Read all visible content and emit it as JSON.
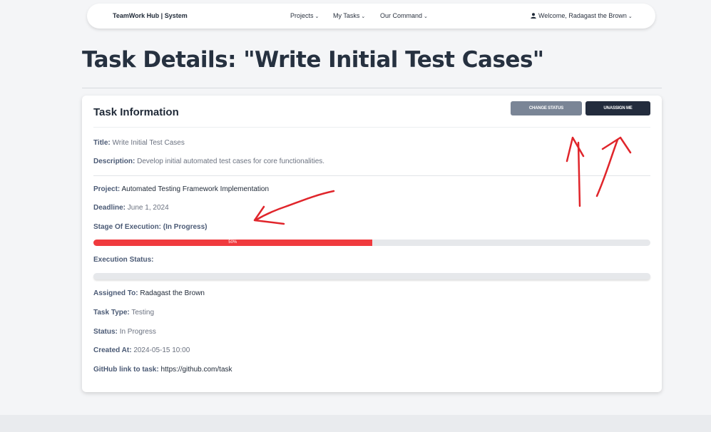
{
  "nav": {
    "brand": "TeamWork Hub | System",
    "projects": "Projects",
    "my_tasks": "My Tasks",
    "our_command": "Our Command",
    "user": "Welcome, Radagast the Brown"
  },
  "page": {
    "title": "Task Details: \"Write Initial Test Cases\""
  },
  "card": {
    "title": "Task Information",
    "change_status_label": "CHANGE STATUS",
    "unassign_label": "UNASSIGN ME"
  },
  "fields": {
    "title_label": "Title:",
    "title_value": "Write Initial Test Cases",
    "description_label": "Description:",
    "description_value": "Develop initial automated test cases for core functionalities.",
    "project_label": "Project:",
    "project_value": "Automated Testing Framework Implementation",
    "deadline_label": "Deadline:",
    "deadline_value": "June 1, 2024",
    "stage_label": "Stage Of Execution: (In Progress)",
    "stage_progress": 50,
    "stage_progress_text": "50%",
    "execution_label": "Execution Status:",
    "execution_progress": 0,
    "assigned_label": "Assigned To:",
    "assigned_value": "Radagast the Brown",
    "task_type_label": "Task Type:",
    "task_type_value": "Testing",
    "status_label": "Status:",
    "status_value": "In Progress",
    "created_label": "Created At:",
    "created_value": "2024-05-15 10:00",
    "github_label": "GitHub link to task:",
    "github_value": "https://github.com/task"
  },
  "colors": {
    "progress_fill": "#f03a3e",
    "annotation": "#e0252b",
    "button_dark": "#232c3d",
    "button_gray": "#7a8596"
  },
  "icons": {
    "user": "user-icon",
    "dropdown": "chevron-down-icon"
  }
}
